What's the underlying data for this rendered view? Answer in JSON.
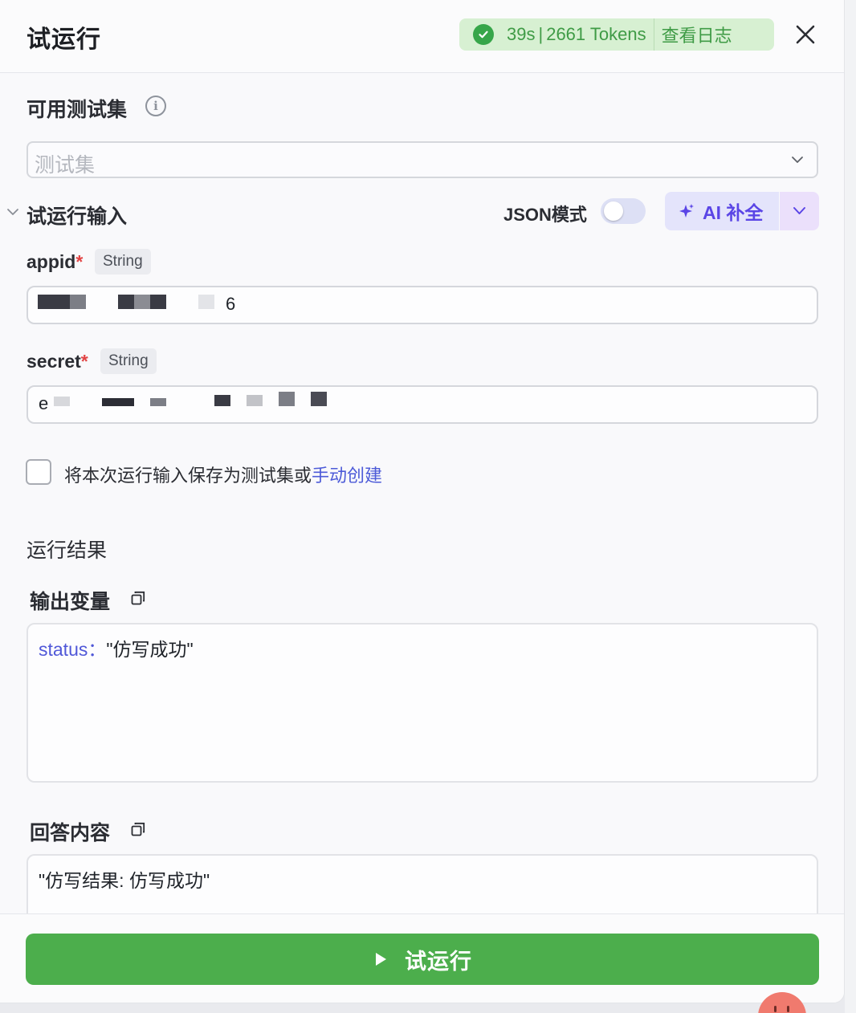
{
  "header": {
    "title": "试运行",
    "status": {
      "duration": "39s",
      "separator": "|",
      "tokens": "2661 Tokens",
      "log_link": "查看日志",
      "color": "#3f9b46"
    }
  },
  "test_set": {
    "label": "可用测试集",
    "placeholder": "测试集"
  },
  "input_section": {
    "title": "试运行输入",
    "json_mode_label": "JSON模式",
    "json_mode_on": false,
    "ai_button_label": "AI 补全",
    "fields": [
      {
        "name": "appid",
        "required_mark": "*",
        "type": "String",
        "value_visible": "6"
      },
      {
        "name": "secret",
        "required_mark": "*",
        "type": "String",
        "value_visible": "e"
      }
    ],
    "save_checkbox": {
      "checked": false,
      "text": "将本次运行输入保存为测试集或",
      "link_text": "手动创建"
    }
  },
  "result_section": {
    "title": "运行结果",
    "output_vars": {
      "label": "输出变量",
      "key": "status",
      "colon": "：",
      "value": "\"仿写成功\""
    },
    "answer": {
      "label": "回答内容",
      "text": "\"仿写结果: 仿写成功\""
    }
  },
  "footer": {
    "run_button_label": "试运行",
    "accent": "#4cae4c"
  },
  "colors": {
    "brand_purple": "#5a45e6",
    "link_blue": "#4d5bd8",
    "required_red": "#e24444"
  }
}
